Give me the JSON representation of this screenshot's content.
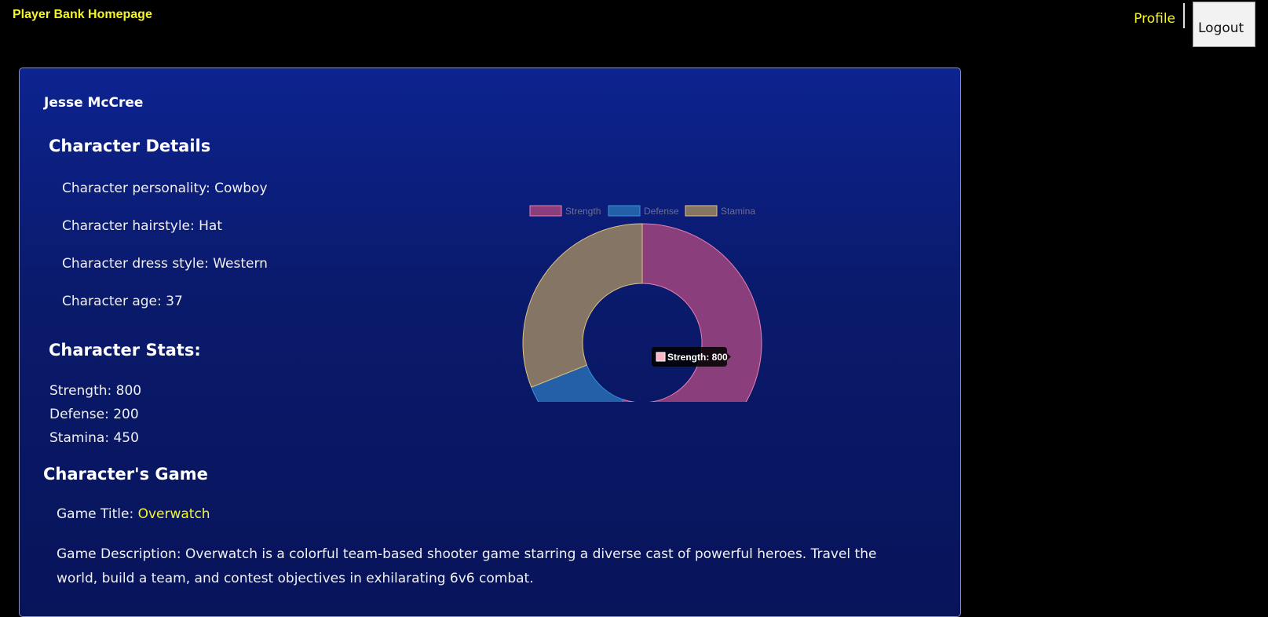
{
  "header": {
    "brand": "Player Bank Homepage",
    "nav": {
      "profile": "Profile",
      "logout": "Logout"
    }
  },
  "character": {
    "name": "Jesse McCree",
    "details_heading": "Character Details",
    "details": [
      "Character personality: Cowboy",
      "Character hairstyle: Hat",
      "Character dress style: Western",
      "Character age: 37"
    ],
    "stats_heading": "Character Stats:",
    "stats": [
      "Strength: 800",
      "Defense: 200",
      "Stamina: 450"
    ]
  },
  "game": {
    "heading": "Character's Game",
    "title_label": "Game Title: ",
    "title_value": "Overwatch",
    "description": "Game Description: Overwatch is a colorful team-based shooter game starring a diverse cast of powerful heroes. Travel the world, build a team, and contest objectives in exhilarating 6v6 combat."
  },
  "chart_data": {
    "type": "pie",
    "variant": "doughnut",
    "categories": [
      "Strength",
      "Defense",
      "Stamina"
    ],
    "values": [
      800,
      200,
      450
    ],
    "colors": [
      "#8a3f7c",
      "#2460a8",
      "#857564"
    ],
    "border_colors": [
      "#e87fb0",
      "#3d8fe0",
      "#e0c080"
    ],
    "legend_placement": "top",
    "tooltip": {
      "label": "Strength: 800",
      "swatch_color": "#ffb3c6"
    }
  }
}
